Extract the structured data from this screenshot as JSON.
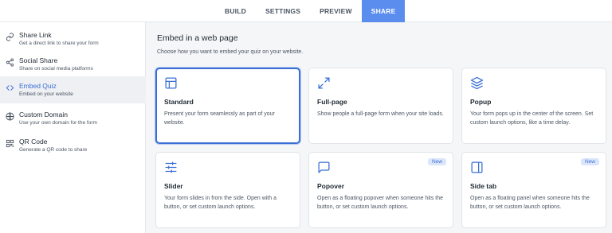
{
  "topbar": {
    "tabs": [
      {
        "label": "BUILD",
        "active": false
      },
      {
        "label": "SETTINGS",
        "active": false
      },
      {
        "label": "PREVIEW",
        "active": false
      },
      {
        "label": "SHARE",
        "active": true
      }
    ]
  },
  "sidebar": {
    "items": [
      {
        "title": "Share Link",
        "subtitle": "Get a direct link to share your form",
        "icon": "link-icon",
        "active": false
      },
      {
        "title": "Social Share",
        "subtitle": "Share on social media platforms",
        "icon": "share-icon",
        "active": false
      },
      {
        "title": "Embed Quiz",
        "subtitle": "Embed on your website",
        "icon": "code-icon",
        "active": true
      },
      {
        "title": "Custom Domain",
        "subtitle": "Use your own domain for the form",
        "icon": "globe-icon",
        "active": false
      },
      {
        "title": "QR Code",
        "subtitle": "Generate a QR code to share",
        "icon": "qr-code-icon",
        "active": false
      }
    ]
  },
  "main": {
    "heading": "Embed in a web page",
    "subheading": "Choose how you want to embed your quiz on your website.",
    "cards": [
      {
        "title": "Standard",
        "description": "Present your form seamlessly as part of your website.",
        "icon": "layout-icon",
        "badge": "",
        "selected": true
      },
      {
        "title": "Full-page",
        "description": "Show people a full-page form when your site loads.",
        "icon": "expand-icon",
        "badge": "",
        "selected": false
      },
      {
        "title": "Popup",
        "description": "Your form pops up in the center of the screen. Set custom launch options, like a time delay.",
        "icon": "layers-icon",
        "badge": "",
        "selected": false
      },
      {
        "title": "Slider",
        "description": "Your form slides in from the side. Open with a button, or set custom launch options.",
        "icon": "sliders-icon",
        "badge": "",
        "selected": false
      },
      {
        "title": "Popover",
        "description": "Open as a floating popover when someone hits the button, or set custom launch options.",
        "icon": "message-square-icon",
        "badge": "New",
        "selected": false
      },
      {
        "title": "Side tab",
        "description": "Open as a floating panel when someone hits the button, or set custom launch options.",
        "icon": "sidebar-panel-icon",
        "badge": "New",
        "selected": false
      }
    ]
  },
  "colors": {
    "accent": "#3b6fd6",
    "active_tab_bg": "#5b8def",
    "badge_bg": "#dbe6fb",
    "page_bg": "#f5f6f7"
  }
}
